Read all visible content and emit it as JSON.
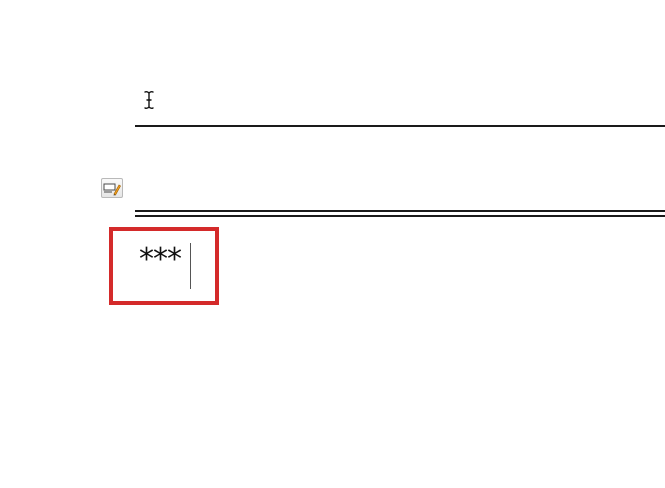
{
  "document": {
    "current_line_text": "***"
  },
  "icons": {
    "mouse_pointer": "ibeam-cursor-icon",
    "autocorrect": "autocorrect-options-icon"
  },
  "colors": {
    "highlight": "#d42a2a",
    "rule": "#1a1a1a",
    "autocorrect_accent": "#f0a020"
  }
}
